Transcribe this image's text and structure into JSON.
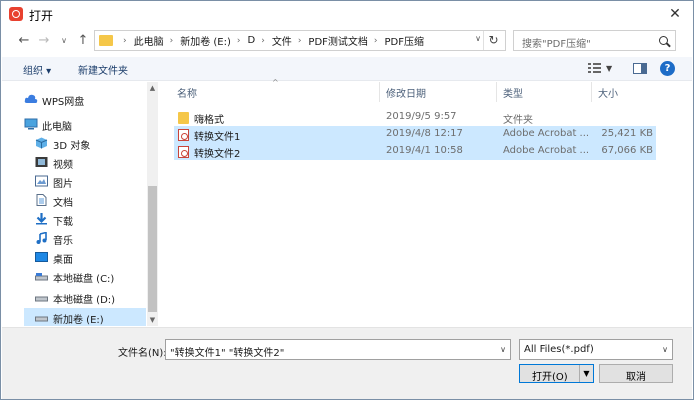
{
  "window": {
    "title": "打开"
  },
  "nav": {
    "back_glyph": "←",
    "forward_glyph": "→",
    "recent_glyph": "∨",
    "up_glyph": "↑",
    "refresh_glyph": "↻"
  },
  "address": {
    "crumbs": [
      "此电脑",
      "新加卷 (E:)",
      "D",
      "文件",
      "PDF测试文档",
      "PDF压缩"
    ],
    "separator": "›"
  },
  "search": {
    "placeholder": "搜索\"PDF压缩\""
  },
  "toolbar": {
    "organize_label": "组织 ▾",
    "new_folder_label": "新建文件夹",
    "help_label": "?"
  },
  "sidebar": {
    "items": [
      {
        "label": "WPS网盘",
        "icon": "cloud-icon"
      },
      {
        "label": "此电脑",
        "icon": "computer-icon"
      },
      {
        "label": "3D 对象",
        "icon": "cube-icon"
      },
      {
        "label": "视频",
        "icon": "video-icon"
      },
      {
        "label": "图片",
        "icon": "picture-icon"
      },
      {
        "label": "文档",
        "icon": "document-icon"
      },
      {
        "label": "下载",
        "icon": "download-icon"
      },
      {
        "label": "音乐",
        "icon": "music-icon"
      },
      {
        "label": "桌面",
        "icon": "desktop-icon"
      },
      {
        "label": "本地磁盘 (C:)",
        "icon": "drive-icon"
      },
      {
        "label": "本地磁盘 (D:)",
        "icon": "drive-icon"
      },
      {
        "label": "新加卷 (E:)",
        "icon": "drive-icon",
        "selected": true
      }
    ]
  },
  "files": {
    "headers": {
      "name": "名称",
      "date": "修改日期",
      "type": "类型",
      "size": "大小"
    },
    "rows": [
      {
        "name": "嗨格式",
        "date": "2019/9/5 9:57",
        "type": "文件夹",
        "size": "",
        "kind": "folder"
      },
      {
        "name": "转换文件1",
        "date": "2019/4/8 12:17",
        "type": "Adobe Acrobat ...",
        "size": "25,421 KB",
        "kind": "pdf",
        "selected": true
      },
      {
        "name": "转换文件2",
        "date": "2019/4/1 10:58",
        "type": "Adobe Acrobat ...",
        "size": "67,066 KB",
        "kind": "pdf",
        "selected": true
      }
    ]
  },
  "bottom": {
    "filename_label": "文件名(N):",
    "filename_value": "\"转换文件1\" \"转换文件2\"",
    "filter_value": "All Files(*.pdf)",
    "open_label": "打开(O)",
    "cancel_label": "取消"
  },
  "colors": {
    "selection": "#cce8ff",
    "accent": "#0078d7",
    "folder": "#f5c749",
    "pdf": "#c9443a"
  }
}
